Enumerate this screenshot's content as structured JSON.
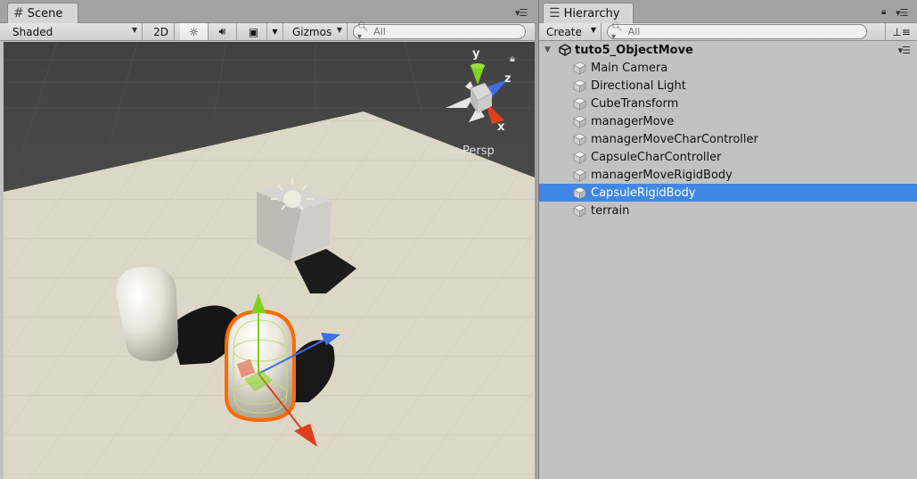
{
  "scene_panel": {
    "tab_label": "Scene",
    "tab_icon": "grid-icon",
    "toolbar": {
      "shading_mode": "Shaded",
      "two_d_label": "2D",
      "gizmos_label": "Gizmos",
      "search_placeholder": "All"
    },
    "viewport": {
      "projection_label": "Persp",
      "axis_labels": {
        "y": "y",
        "z": "z",
        "x": "x"
      }
    }
  },
  "hierarchy_panel": {
    "tab_label": "Hierarchy",
    "create_label": "Create",
    "search_placeholder": "All",
    "scene_name": "tuto5_ObjectMove",
    "items": [
      {
        "label": "Main Camera",
        "selected": false
      },
      {
        "label": "Directional Light",
        "selected": false
      },
      {
        "label": "CubeTransform",
        "selected": false
      },
      {
        "label": "managerMove",
        "selected": false
      },
      {
        "label": "managerMoveCharController",
        "selected": false
      },
      {
        "label": "CapsuleCharController",
        "selected": false
      },
      {
        "label": "managerMoveRigidBody",
        "selected": false
      },
      {
        "label": "CapsuleRigidBody",
        "selected": true
      },
      {
        "label": "terrain",
        "selected": false
      }
    ]
  },
  "colors": {
    "selection": "#3f86e5",
    "sky": "#444444",
    "ground": "#dcd7c6",
    "selection_outline": "#ff6a00",
    "axis_x": "#e03e1c",
    "axis_y": "#80d01e",
    "axis_z": "#3b6fe6"
  }
}
